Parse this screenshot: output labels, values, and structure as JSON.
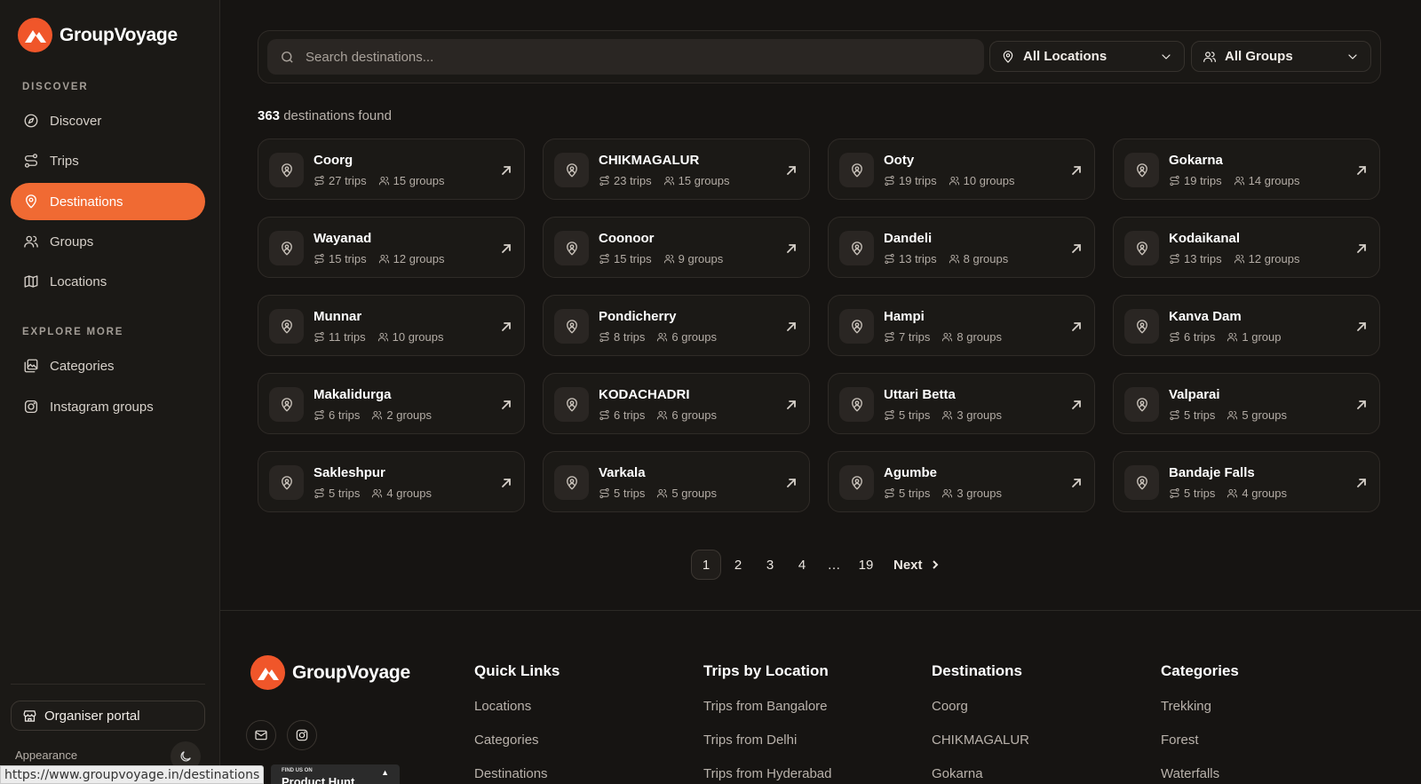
{
  "brand": {
    "name": "GroupVoyage",
    "accent": "#f06a33"
  },
  "sidebar": {
    "section_discover": "DISCOVER",
    "nav": [
      {
        "label": "Discover",
        "icon": "compass-icon"
      },
      {
        "label": "Trips",
        "icon": "route-icon"
      },
      {
        "label": "Destinations",
        "icon": "map-pin-icon",
        "active": true
      },
      {
        "label": "Groups",
        "icon": "users-icon"
      },
      {
        "label": "Locations",
        "icon": "map-icon"
      }
    ],
    "section_explore": "EXPLORE MORE",
    "explore": [
      {
        "label": "Categories",
        "icon": "gallery-icon"
      },
      {
        "label": "Instagram groups",
        "icon": "instagram-icon"
      }
    ],
    "organiser_portal": "Organiser portal",
    "appearance": "Appearance"
  },
  "search": {
    "placeholder": "Search destinations..."
  },
  "filters": {
    "location": "All Locations",
    "groups": "All Groups"
  },
  "results": {
    "count": "363",
    "suffix": "destinations found"
  },
  "destinations": [
    {
      "name": "Coorg",
      "trips": "27 trips",
      "groups": "15 groups"
    },
    {
      "name": "CHIKMAGALUR",
      "trips": "23 trips",
      "groups": "15 groups"
    },
    {
      "name": "Ooty",
      "trips": "19 trips",
      "groups": "10 groups"
    },
    {
      "name": "Gokarna",
      "trips": "19 trips",
      "groups": "14 groups"
    },
    {
      "name": "Wayanad",
      "trips": "15 trips",
      "groups": "12 groups"
    },
    {
      "name": "Coonoor",
      "trips": "15 trips",
      "groups": "9 groups"
    },
    {
      "name": "Dandeli",
      "trips": "13 trips",
      "groups": "8 groups"
    },
    {
      "name": "Kodaikanal",
      "trips": "13 trips",
      "groups": "12 groups"
    },
    {
      "name": "Munnar",
      "trips": "11 trips",
      "groups": "10 groups"
    },
    {
      "name": "Pondicherry",
      "trips": "8 trips",
      "groups": "6 groups"
    },
    {
      "name": "Hampi",
      "trips": "7 trips",
      "groups": "8 groups"
    },
    {
      "name": "Kanva Dam",
      "trips": "6 trips",
      "groups": "1 group"
    },
    {
      "name": "Makalidurga",
      "trips": "6 trips",
      "groups": "2 groups"
    },
    {
      "name": "KODACHADRI",
      "trips": "6 trips",
      "groups": "6 groups"
    },
    {
      "name": "Uttari Betta",
      "trips": "5 trips",
      "groups": "3 groups"
    },
    {
      "name": "Valparai",
      "trips": "5 trips",
      "groups": "5 groups"
    },
    {
      "name": "Sakleshpur",
      "trips": "5 trips",
      "groups": "4 groups"
    },
    {
      "name": "Varkala",
      "trips": "5 trips",
      "groups": "5 groups"
    },
    {
      "name": "Agumbe",
      "trips": "5 trips",
      "groups": "3 groups"
    },
    {
      "name": "Bandaje Falls",
      "trips": "5 trips",
      "groups": "4 groups"
    }
  ],
  "pagination": {
    "pages": [
      "1",
      "2",
      "3",
      "4",
      "…",
      "19"
    ],
    "current": "1",
    "next": "Next"
  },
  "footer": {
    "brand": "GroupVoyage",
    "columns": [
      {
        "title": "Quick Links",
        "links": [
          "Locations",
          "Categories",
          "Destinations"
        ]
      },
      {
        "title": "Trips by Location",
        "links": [
          "Trips from Bangalore",
          "Trips from Delhi",
          "Trips from Hyderabad"
        ]
      },
      {
        "title": "Destinations",
        "links": [
          "Coorg",
          "CHIKMAGALUR",
          "Gokarna"
        ]
      },
      {
        "title": "Categories",
        "links": [
          "Trekking",
          "Forest",
          "Waterfalls"
        ]
      }
    ]
  },
  "status_bar": {
    "url": "https://www.groupvoyage.in/destinations",
    "badge_small": "FIND US ON",
    "badge_big": "Product Hunt",
    "badge_arrow": "▲"
  }
}
